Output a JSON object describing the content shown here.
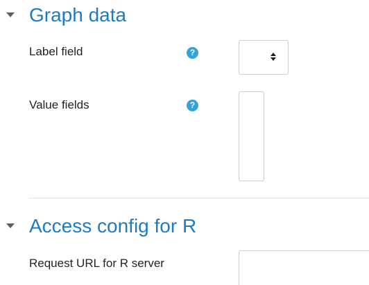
{
  "sections": [
    {
      "title": "Graph data",
      "fields": [
        {
          "label": "Label field",
          "help": "?",
          "control": "select"
        },
        {
          "label": "Value fields",
          "help": "?",
          "control": "multiselect"
        }
      ]
    },
    {
      "title": "Access config for R",
      "fields": [
        {
          "label": "Request URL for R server",
          "value": "",
          "control": "text"
        }
      ]
    }
  ],
  "colors": {
    "section_title": "#1f7bc1",
    "help_icon": "#36a3d8",
    "label_text": "#1d2125",
    "border": "#c9ced3"
  },
  "icons": {
    "collapse": "chevron-down-icon",
    "help": "question-circle-icon"
  }
}
